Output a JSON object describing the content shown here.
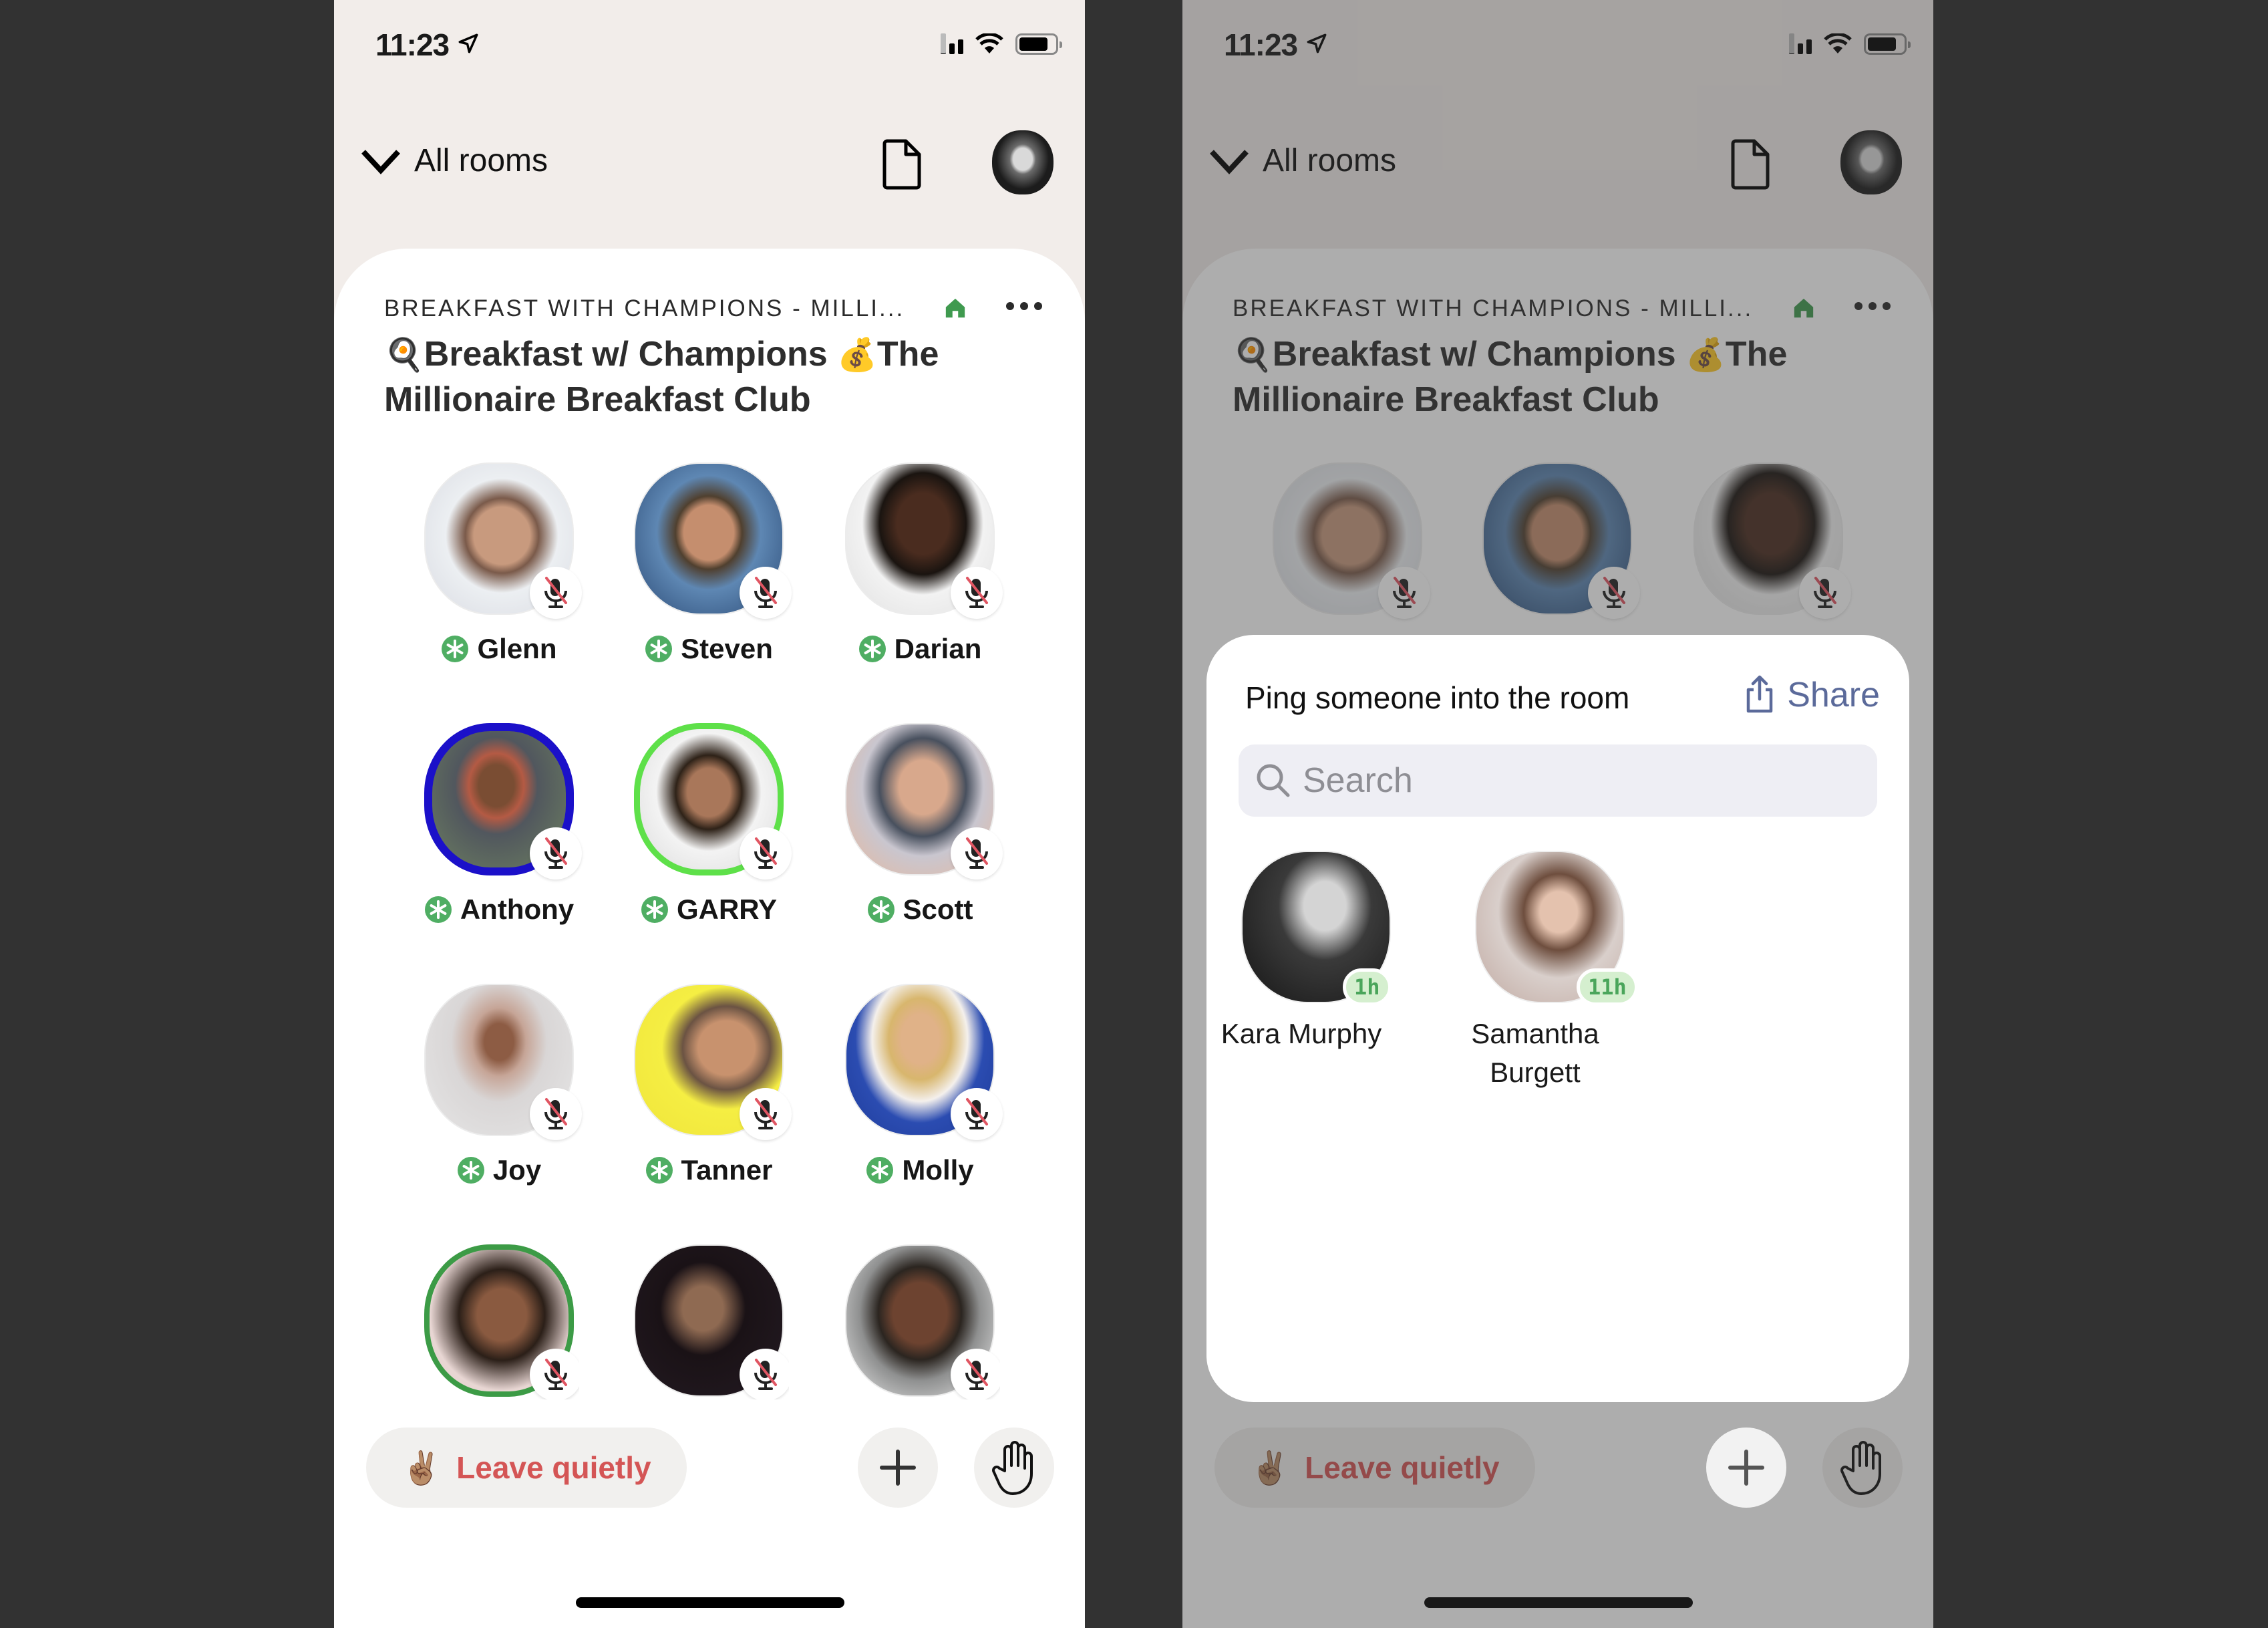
{
  "status_bar": {
    "time": "11:23"
  },
  "nav": {
    "all_rooms_label": "All rooms"
  },
  "room": {
    "club_name": "BREAKFAST WITH CHAMPIONS - MILLI...",
    "title_emoji_1": "🍳",
    "title_part_1": "Breakfast w/ Champions ",
    "title_emoji_2": "💰",
    "title_part_2": "The Millionaire Breakfast Club"
  },
  "speakers": [
    {
      "name": "Glenn",
      "moderator": true,
      "muted": true,
      "ring": "none"
    },
    {
      "name": "Steven",
      "moderator": true,
      "muted": true,
      "ring": "none"
    },
    {
      "name": "Darian",
      "moderator": true,
      "muted": true,
      "ring": "none"
    },
    {
      "name": "Anthony",
      "moderator": true,
      "muted": true,
      "ring": "blue"
    },
    {
      "name": "GARRY",
      "moderator": true,
      "muted": true,
      "ring": "green"
    },
    {
      "name": "Scott",
      "moderator": true,
      "muted": true,
      "ring": "none"
    },
    {
      "name": "Joy",
      "moderator": true,
      "muted": true,
      "ring": "none"
    },
    {
      "name": "Tanner",
      "moderator": true,
      "muted": true,
      "ring": "none"
    },
    {
      "name": "Molly",
      "moderator": true,
      "muted": true,
      "ring": "none"
    },
    {
      "name": "",
      "moderator": false,
      "muted": true,
      "ring": "darkgreen"
    },
    {
      "name": "",
      "moderator": false,
      "muted": true,
      "ring": "none"
    },
    {
      "name": "",
      "moderator": false,
      "muted": true,
      "ring": "none"
    }
  ],
  "bottom_bar": {
    "leave_emoji": "✌🏽",
    "leave_label": "Leave quietly"
  },
  "ping_sheet": {
    "title": "Ping someone into the room",
    "share_label": "Share",
    "search_placeholder": "Search",
    "people": [
      {
        "name": "Kara Murphy",
        "last_active": "1h"
      },
      {
        "name": "Samantha Burgett",
        "last_active": "11h"
      }
    ]
  },
  "colors": {
    "header_bg": "#f2edea",
    "leave_text": "#d45555",
    "moderator_green": "#4fae63",
    "share_blue": "#5b6a9a",
    "badge_green_bg": "#d5efcf",
    "badge_green_text": "#4aa55b"
  }
}
